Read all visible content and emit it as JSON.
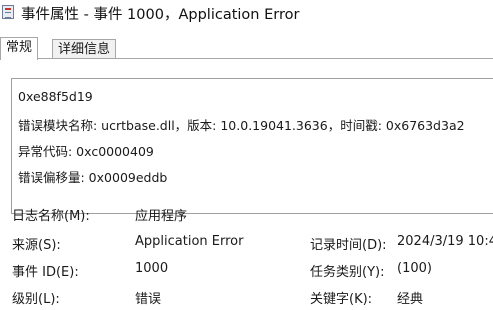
{
  "window": {
    "title": "事件属性 - 事件 1000，Application Error",
    "icon": "event-viewer-icon"
  },
  "tabs": [
    {
      "label": "常规",
      "active": true
    },
    {
      "label": "详细信息",
      "active": false
    }
  ],
  "description": {
    "lines": [
      "0xe88f5d19",
      "错误模块名称: ucrtbase.dll，版本: 10.0.19041.3636，时间戳: 0x6763d3a2",
      "异常代码: 0xc0000409",
      "错误偏移量: 0x0009eddb"
    ]
  },
  "properties": {
    "log_name": {
      "label": "日志名称(M):",
      "value": "应用程序"
    },
    "source": {
      "label": "来源(S):",
      "value": "Application Error"
    },
    "logged": {
      "label": "记录时间(D):",
      "value": "2024/3/19 10:4"
    },
    "event_id": {
      "label": "事件 ID(E):",
      "value": "1000"
    },
    "task_category": {
      "label": "任务类别(Y):",
      "value": "(100)"
    },
    "level": {
      "label": "级别(L):",
      "value": "错误"
    },
    "keywords": {
      "label": "关键字(K):",
      "value": "经典"
    }
  }
}
